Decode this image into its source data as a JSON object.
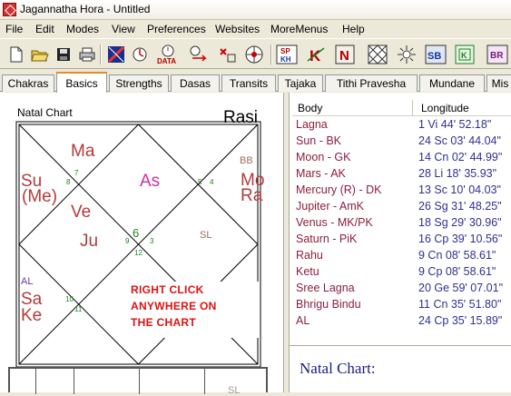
{
  "window": {
    "title": "Jagannatha Hora - Untitled"
  },
  "menu": [
    "File",
    "Edit",
    "Modes",
    "View",
    "Preferences",
    "Websites",
    "MoreMenus",
    "Help"
  ],
  "toolbar": {
    "icons": [
      "new-file-icon",
      "open-folder-icon",
      "save-icon",
      "print-icon",
      "chart-style-icon",
      "data-icon",
      "transit-icon",
      "move-icon",
      "rotate-icon",
      "sp-kh-icon",
      "k-icon",
      "n-icon",
      "chart-icon",
      "sun-icon",
      "sb-icon",
      "k-box-icon",
      "br-icon"
    ],
    "labels": {
      "data": "DATA",
      "sp": "SP",
      "kh": "KH",
      "k": "K",
      "n": "N",
      "sb": "SB",
      "br": "BR"
    }
  },
  "tabs": [
    "Chakras",
    "Basics",
    "Strengths",
    "Dasas",
    "Transits",
    "Tajaka",
    "Tithi Pravesha",
    "Mundane",
    "Mis"
  ],
  "active_tab": "Basics",
  "chart": {
    "heading": "Natal Chart",
    "name": "Rasi",
    "planets": {
      "ma": "Ma",
      "su": "Su",
      "me": "(Me)",
      "as": "As",
      "ve": "Ve",
      "ju": "Ju",
      "bb": "BB",
      "mo": "Mo",
      "ra": "Ra",
      "sl": "SL",
      "al": "AL",
      "sa": "Sa",
      "ke": "Ke",
      "sl_bottom": "SL"
    },
    "houses": [
      "7",
      "8",
      "5",
      "4",
      "6",
      "9",
      "3",
      "12",
      "10",
      "11"
    ],
    "notice_lines": [
      "RIGHT CLICK",
      "ANYWHERE ON",
      "THE CHART"
    ]
  },
  "table": {
    "headers": {
      "body": "Body",
      "longitude": "Longitude"
    },
    "rows": [
      {
        "body": "Lagna",
        "longitude": "1 Vi 44' 52.18\""
      },
      {
        "body": "Sun - BK",
        "longitude": "24 Sc 03' 44.04\""
      },
      {
        "body": "Moon - GK",
        "longitude": "14 Cn 02' 44.99\""
      },
      {
        "body": "Mars - AK",
        "longitude": "28 Li 18' 35.93\""
      },
      {
        "body": "Mercury (R) - DK",
        "longitude": "13 Sc 10' 04.03\""
      },
      {
        "body": "Jupiter - AmK",
        "longitude": "26 Sg 31' 48.25\""
      },
      {
        "body": "Venus - MK/PK",
        "longitude": "18 Sg 29' 30.96\""
      },
      {
        "body": "Saturn - PiK",
        "longitude": "16 Cp 39' 10.56\""
      },
      {
        "body": "Rahu",
        "longitude": "9 Cn 08' 58.61\""
      },
      {
        "body": "Ketu",
        "longitude": "9 Cp 08' 58.61\""
      },
      {
        "body": "Sree Lagna",
        "longitude": "20 Ge 59' 07.01\""
      },
      {
        "body": "Bhrigu Bindu",
        "longitude": "11 Cn 35' 51.80\""
      },
      {
        "body": "AL",
        "longitude": "24 Cp 35' 15.89\""
      }
    ]
  },
  "lower_panel": {
    "heading": "Natal Chart:"
  }
}
